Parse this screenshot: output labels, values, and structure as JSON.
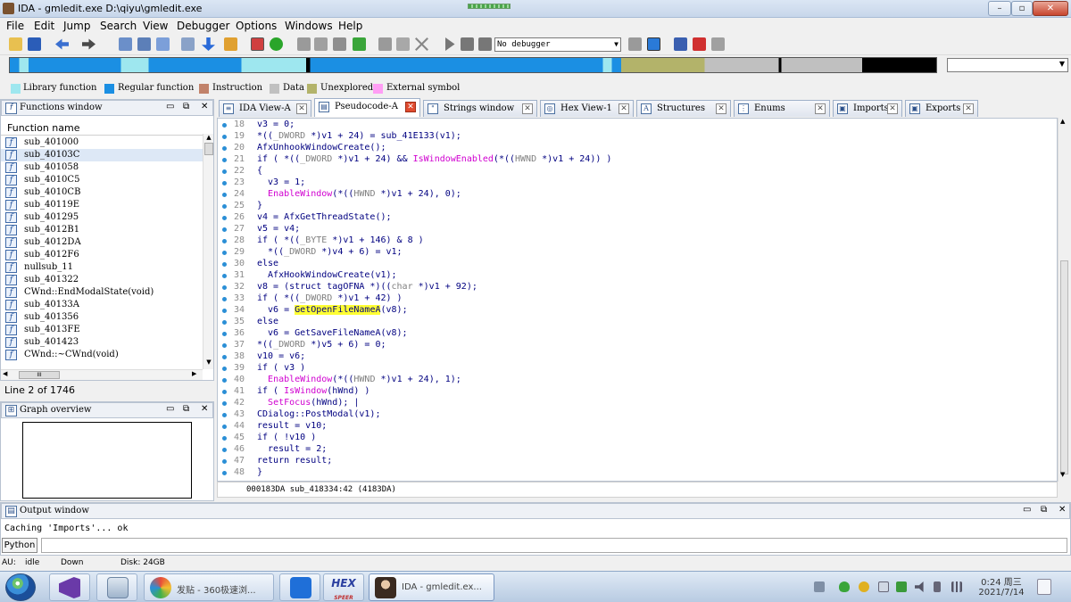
{
  "window": {
    "title": "IDA - gmledit.exe D:\\qiyu\\gmledit.exe",
    "minimize_symbol": "–",
    "maximize_symbol": "▫",
    "close_symbol": "✕",
    "icon": "ida-app-icon"
  },
  "menu": [
    "File",
    "Edit",
    "Jump",
    "Search",
    "View",
    "Debugger",
    "Options",
    "Windows",
    "Help"
  ],
  "toolbar": {
    "debugger_select": "No debugger"
  },
  "legend": [
    {
      "label": "Library function",
      "color": "#9ee7ef"
    },
    {
      "label": "Regular function",
      "color": "#1b8fe3"
    },
    {
      "label": "Instruction",
      "color": "#c1826a"
    },
    {
      "label": "Data",
      "color": "#c0c0c0"
    },
    {
      "label": "Unexplored",
      "color": "#b3b36a"
    },
    {
      "label": "External symbol",
      "color": "#ff9ef5"
    }
  ],
  "functions_panel": {
    "title": "Functions window",
    "column": "Function name",
    "items": [
      "sub_401000",
      "sub_40103C",
      "sub_401058",
      "sub_4010C5",
      "sub_4010CB",
      "sub_40119E",
      "sub_401295",
      "sub_4012B1",
      "sub_4012DA",
      "sub_4012F6",
      "nullsub_11",
      "sub_401322",
      "CWnd::EndModalState(void)",
      "sub_40133A",
      "sub_401356",
      "sub_4013FE",
      "sub_401423",
      "CWnd::~CWnd(void)"
    ],
    "selected_index": 1,
    "scroll_label": "III",
    "status": "Line 2 of 1746"
  },
  "graph_panel": {
    "title": "Graph overview"
  },
  "tabs": [
    {
      "label": "IDA View-A",
      "icon": "ida-view-icon",
      "active": false
    },
    {
      "label": "Pseudocode-A",
      "icon": "pseudocode-icon",
      "active": true
    },
    {
      "label": "Strings window",
      "icon": "strings-icon",
      "active": false
    },
    {
      "label": "Hex View-1",
      "icon": "hex-view-icon",
      "active": false
    },
    {
      "label": "Structures",
      "icon": "structures-icon",
      "active": false
    },
    {
      "label": "Enums",
      "icon": "enums-icon",
      "active": false
    },
    {
      "label": "Imports",
      "icon": "imports-icon",
      "active": false
    },
    {
      "label": "Exports",
      "icon": "exports-icon",
      "active": false
    }
  ],
  "code": [
    {
      "ln": "18",
      "text": "v3 = 0;"
    },
    {
      "ln": "19",
      "text": "*((_DWORD *)v1 + 24) = sub_41E133(v1);"
    },
    {
      "ln": "20",
      "text": "AfxUnhookWindowCreate();"
    },
    {
      "ln": "21",
      "text": "if ( *((_DWORD *)v1 + 24) && IsWindowEnabled(*((HWND *)v1 + 24)) )"
    },
    {
      "ln": "22",
      "text": "{"
    },
    {
      "ln": "23",
      "text": "  v3 = 1;"
    },
    {
      "ln": "24",
      "text": "  EnableWindow(*((HWND *)v1 + 24), 0);"
    },
    {
      "ln": "25",
      "text": "}"
    },
    {
      "ln": "26",
      "text": "v4 = AfxGetThreadState();"
    },
    {
      "ln": "27",
      "text": "v5 = v4;"
    },
    {
      "ln": "28",
      "text": "if ( *((_BYTE *)v1 + 146) & 8 )"
    },
    {
      "ln": "29",
      "text": "  *((_DWORD *)v4 + 6) = v1;"
    },
    {
      "ln": "30",
      "text": "else"
    },
    {
      "ln": "31",
      "text": "  AfxHookWindowCreate(v1);"
    },
    {
      "ln": "32",
      "text": "v8 = (struct tagOFNA *)((char *)v1 + 92);"
    },
    {
      "ln": "33",
      "text": "if ( *((_DWORD *)v1 + 42) )"
    },
    {
      "ln": "34",
      "text": "  v6 = GetOpenFileNameA(v8);"
    },
    {
      "ln": "35",
      "text": "else"
    },
    {
      "ln": "36",
      "text": "  v6 = GetSaveFileNameA(v8);"
    },
    {
      "ln": "37",
      "text": "*((_DWORD *)v5 + 6) = 0;"
    },
    {
      "ln": "38",
      "text": "v10 = v6;"
    },
    {
      "ln": "39",
      "text": "if ( v3 )"
    },
    {
      "ln": "40",
      "text": "  EnableWindow(*((HWND *)v1 + 24), 1);"
    },
    {
      "ln": "41",
      "text": "if ( IsWindow(hWnd) )"
    },
    {
      "ln": "42",
      "text": "  SetFocus(hWnd); |"
    },
    {
      "ln": "43",
      "text": "CDialog::PostModal(v1);"
    },
    {
      "ln": "44",
      "text": "result = v10;"
    },
    {
      "ln": "45",
      "text": "if ( !v10 )"
    },
    {
      "ln": "46",
      "text": "  result = 2;"
    },
    {
      "ln": "47",
      "text": "return result;"
    },
    {
      "ln": "48",
      "text": "}"
    }
  ],
  "code_status": "000183DA sub_418334:42 (4183DA)",
  "output": {
    "title": "Output window",
    "text": "Caching 'Imports'... ok",
    "python_label": "Python"
  },
  "statusbar": {
    "au": "AU:",
    "state": "idle",
    "direction": "Down",
    "disk": "Disk: 24GB"
  },
  "taskbar": {
    "tasks": [
      {
        "label": "",
        "icon": "visual-studio-icon"
      },
      {
        "label": "",
        "icon": "calculator-icon"
      },
      {
        "label": "发贴 - 360极速浏...",
        "icon": "browser-360-icon"
      },
      {
        "label": "",
        "icon": "shield-u-icon"
      },
      {
        "label": "",
        "icon": "hex-editor-icon"
      },
      {
        "label": "IDA - gmledit.ex...",
        "icon": "ida-task-icon"
      }
    ],
    "hex_icon_text": "HEX",
    "hex_icon_sub": "SPEER",
    "time": "0:24 周三",
    "date": "2021/7/14"
  },
  "colors": {
    "highlight": "#ffff33",
    "function_name": "#d000d0",
    "keyword": "#000080",
    "type": "#808080"
  }
}
